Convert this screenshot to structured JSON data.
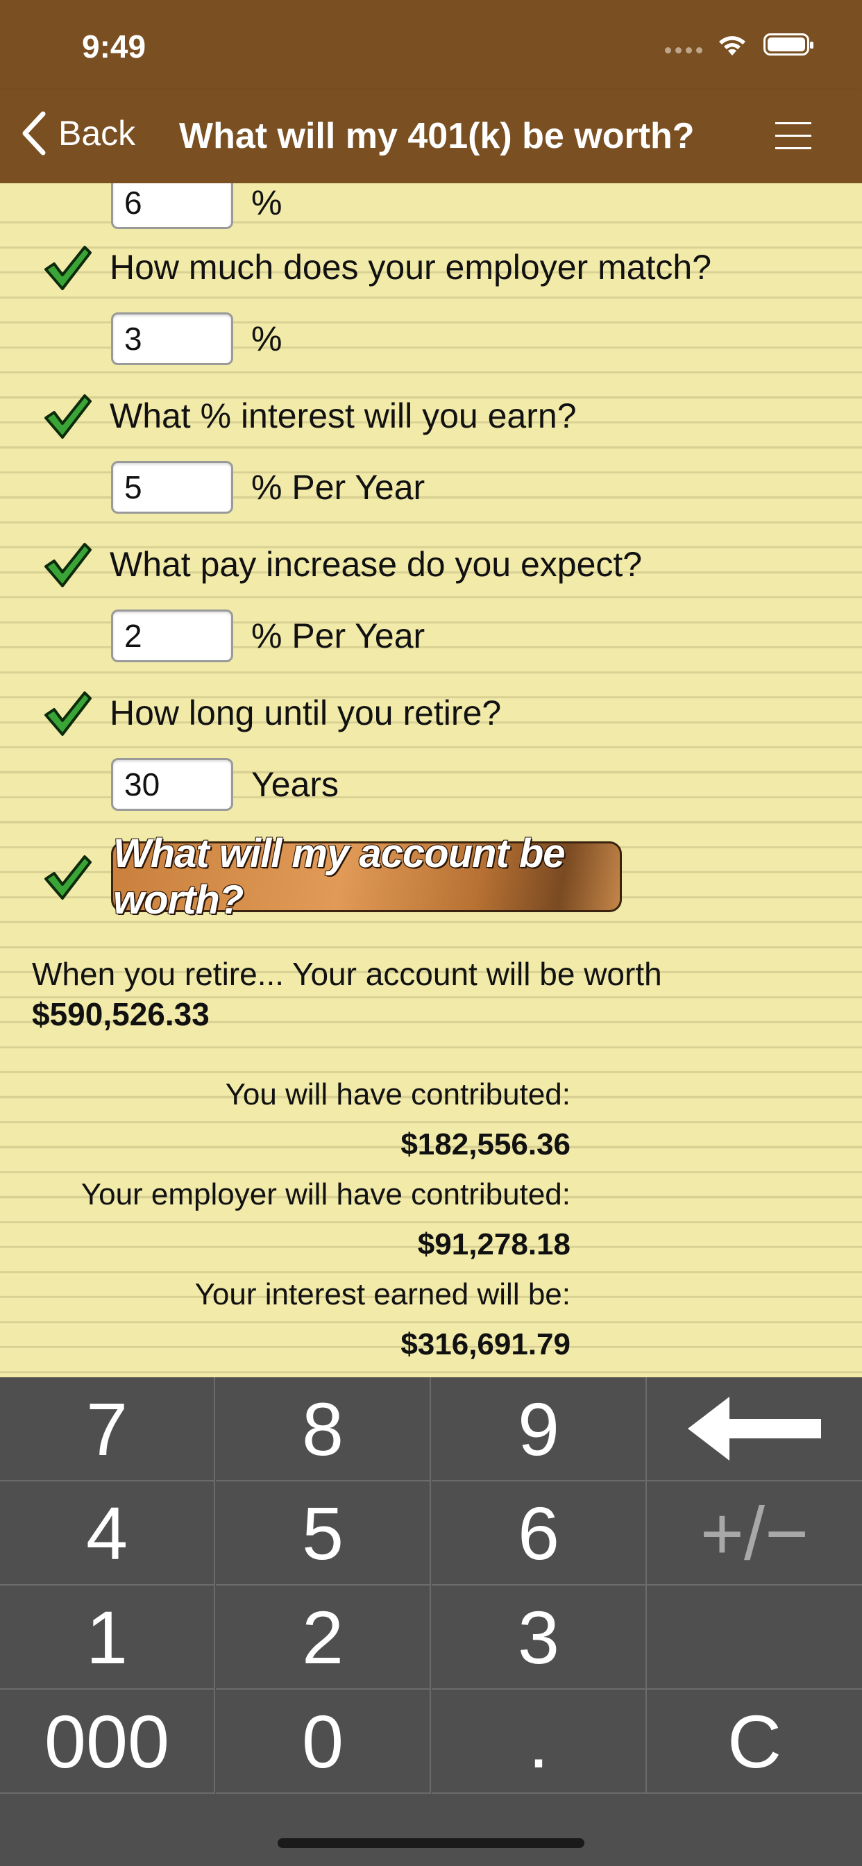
{
  "status": {
    "time": "9:49"
  },
  "nav": {
    "back_label": "Back",
    "title": "What will my 401(k) be worth?"
  },
  "form": {
    "top_field": {
      "value": "6",
      "unit": "%"
    },
    "questions": [
      {
        "label": "How much does your employer match?",
        "value": "3",
        "unit": "%"
      },
      {
        "label": "What % interest will you earn?",
        "value": "5",
        "unit": "% Per Year"
      },
      {
        "label": "What pay increase do you expect?",
        "value": "2",
        "unit": "% Per Year"
      },
      {
        "label": "How long until you retire?",
        "value": "30",
        "unit": "Years"
      }
    ],
    "calculate_label": "What will my account be worth?"
  },
  "results": {
    "summary": "When you retire... Your account will be worth",
    "total": "$590,526.33",
    "contributed_label": "You will have contributed:",
    "contributed_value": "$182,556.36",
    "employer_label": "Your employer will have contributed:",
    "employer_value": "$91,278.18",
    "interest_label": "Your interest earned will be:",
    "interest_value": "$316,691.79"
  },
  "keypad": {
    "keys": [
      "7",
      "8",
      "9",
      "4",
      "5",
      "6",
      "+/−",
      "1",
      "2",
      "3",
      "000",
      "0",
      ".",
      "C"
    ]
  },
  "colors": {
    "bar": "#7a4f21",
    "paper": "#f1eaa9",
    "keypad": "#4f4f4f",
    "check": "#3aa536"
  }
}
